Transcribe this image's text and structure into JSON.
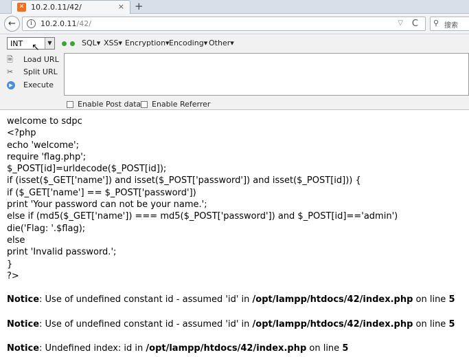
{
  "tab": {
    "title": "10.2.0.11/42/",
    "close": "×",
    "new_tab": "+"
  },
  "nav": {
    "back": "←",
    "url_host": "10.2.0.11",
    "url_path": "/42/",
    "dropdown": "▽",
    "reload": "C",
    "search_placeholder": "搜索"
  },
  "hackbar": {
    "select_value": "INT",
    "menus": [
      "SQL▾",
      "XSS▾",
      "Encryption▾",
      "Encoding▾",
      "Other▾"
    ],
    "actions": [
      "Load URL",
      "Split URL",
      "Execute"
    ],
    "checkboxes": [
      "Enable Post data",
      "Enable Referrer"
    ]
  },
  "page": {
    "lines": [
      "welcome to sdpc",
      "<?php",
      "echo 'welcome';",
      "require 'flag.php';",
      "$_POST[id]=urldecode($_POST[id]);",
      "if (isset($_GET['name']) and isset($_POST['password']) and isset($_POST[id])) {",
      "if ($_GET['name'] == $_POST['password'])",
      "print 'Your password can not be your name.';",
      "else if (md5($_GET['name']) === md5($_POST['password']) and $_POST[id]=='admin')",
      "die('Flag: '.$flag);",
      "else",
      "print 'Invalid password.';",
      "}",
      "?>"
    ],
    "notices": [
      {
        "label": "Notice",
        "text": ": Use of undefined constant id - assumed 'id' in ",
        "path": "/opt/lampp/htdocs/42/index.php",
        "on_line": " on line ",
        "line": "5"
      },
      {
        "label": "Notice",
        "text": ": Use of undefined constant id - assumed 'id' in ",
        "path": "/opt/lampp/htdocs/42/index.php",
        "on_line": " on line ",
        "line": "5"
      },
      {
        "label": "Notice",
        "text": ": Undefined index: id in ",
        "path": "/opt/lampp/htdocs/42/index.php",
        "on_line": " on line ",
        "line": "5"
      }
    ]
  }
}
